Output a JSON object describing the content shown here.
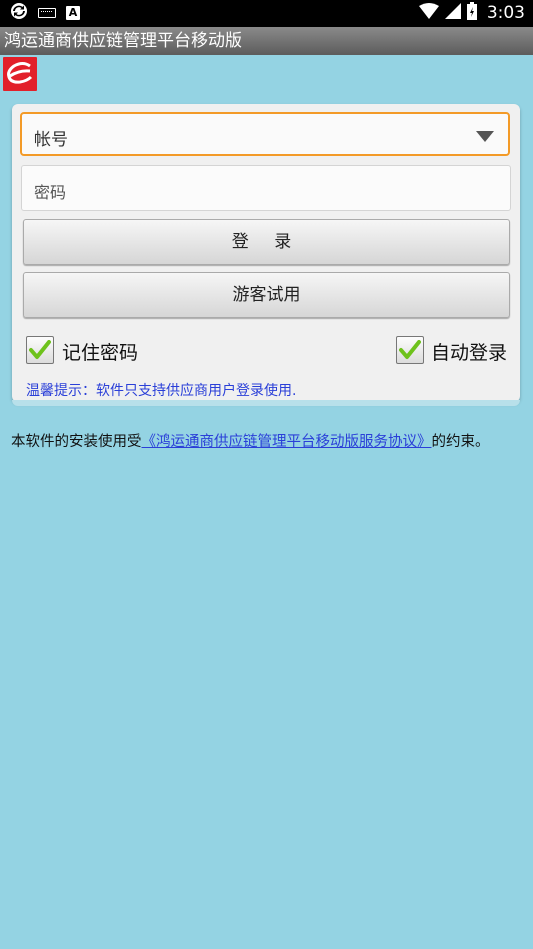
{
  "status_bar": {
    "time": "3:03",
    "left_icons": [
      "sync-icon",
      "keyboard-icon",
      "a-notification-icon"
    ],
    "right_icons": [
      "wifi-icon",
      "signal-icon",
      "battery-icon"
    ]
  },
  "app": {
    "title": "鸿运通商供应链管理平台移动版",
    "logo_icon": "brand-logo-icon",
    "accent_color": "#f39a27",
    "logo_color": "#e2202a"
  },
  "login": {
    "account_value": "帐号",
    "password_placeholder": "密码",
    "login_button": "登 录",
    "guest_button": "游客试用",
    "remember_label": "记住密码",
    "remember_checked": true,
    "auto_login_label": "自动登录",
    "auto_login_checked": true,
    "hint": "温馨提示：软件只支持供应商用户登录使用."
  },
  "agreement": {
    "prefix": "本软件的安装使用受",
    "link_text": "《鸿运通商供应链管理平台移动版服务协议》",
    "suffix": "的约束。"
  }
}
